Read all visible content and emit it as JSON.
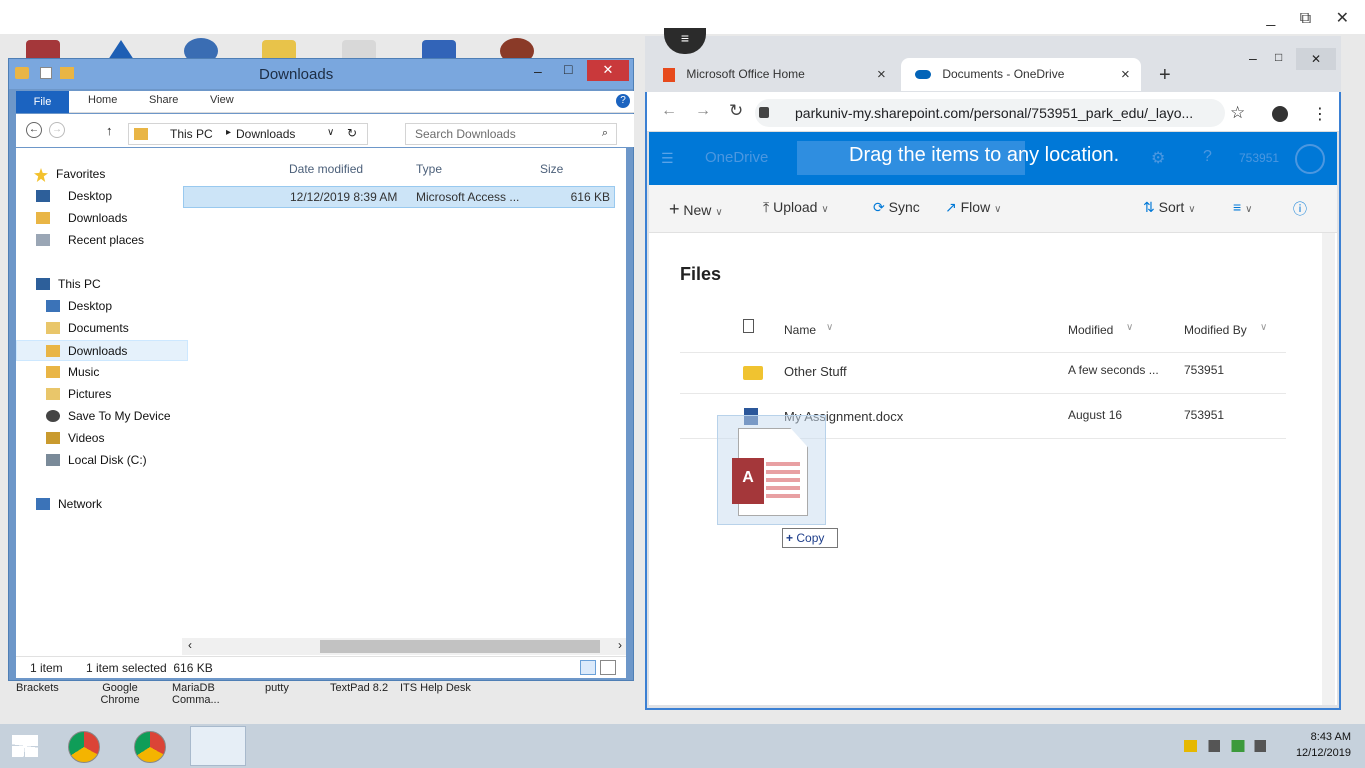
{
  "remote": {
    "window_controls": "_  ⧉  ✕"
  },
  "desktop_labels": [
    "Brackets",
    "Google\nChrome",
    "MariaDB\nComma...",
    "putty",
    "TextPad 8.2",
    "ITS Help Desk"
  ],
  "explorer": {
    "title": "Downloads",
    "ribbon_tabs": [
      "File",
      "Home",
      "Share",
      "View"
    ],
    "breadcrumb": [
      "This PC",
      "Downloads"
    ],
    "search_placeholder": "Search Downloads",
    "nav": {
      "favorites": "Favorites",
      "fav_items": [
        "Desktop",
        "Downloads",
        "Recent places"
      ],
      "this_pc": "This PC",
      "pc_items": [
        "Desktop",
        "Documents",
        "Downloads",
        "Music",
        "Pictures",
        "Save To My Device",
        "Videos",
        "Local Disk (C:)"
      ],
      "network": "Network"
    },
    "columns": [
      "Date modified",
      "Type",
      "Size"
    ],
    "file": {
      "date": "12/12/2019 8:39 AM",
      "type": "Microsoft Access ...",
      "size": "616 KB"
    },
    "status": {
      "count": "1 item",
      "selected": "1 item selected  616 KB"
    }
  },
  "browser": {
    "tabs": [
      {
        "label": "Microsoft Office Home",
        "close": "×"
      },
      {
        "label": "Documents - OneDrive",
        "close": "×"
      }
    ],
    "new_tab": "+",
    "url": "parkuniv-my.sharepoint.com/personal/753951_park_edu/_layo...",
    "onedrive": {
      "brand": "OneDrive",
      "drag_msg": "Drag the items to any location.",
      "user": "753951",
      "toolbar": {
        "new": "New",
        "upload": "Upload",
        "sync": "Sync",
        "flow": "Flow",
        "sort": "Sort"
      },
      "heading": "Files",
      "columns": {
        "name": "Name",
        "modified": "Modified",
        "modified_by": "Modified By"
      },
      "rows": [
        {
          "name": "Other Stuff",
          "modified": "A few seconds ...",
          "by": "753951"
        },
        {
          "name": "My Assignment.docx",
          "modified": "August 16",
          "by": "753951"
        }
      ]
    }
  },
  "drag": {
    "tip": "Copy"
  },
  "taskbar": {
    "time": "8:43 AM",
    "date": "12/12/2019"
  },
  "colors": {
    "onedrive_blue": "#0078d7",
    "selection": "#cce4f7",
    "close_red": "#c9393b"
  }
}
